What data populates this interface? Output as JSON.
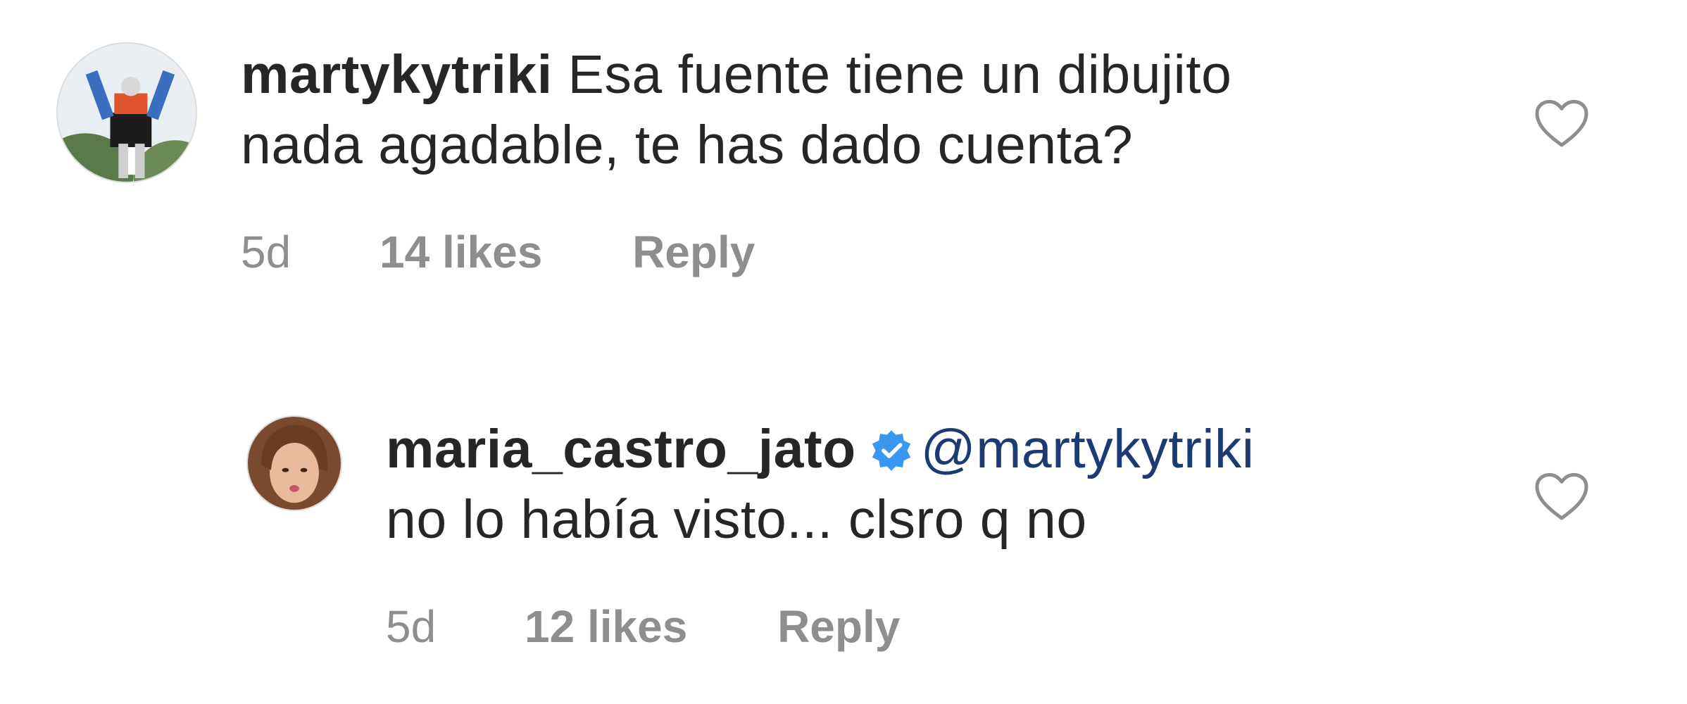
{
  "comments": [
    {
      "username": "martykytriki",
      "text_line1": "Esa fuente tiene un dibujito",
      "text_line2": "nada agadable, te has dado cuenta?",
      "time": "5d",
      "likes": "14 likes",
      "reply": "Reply",
      "verified": false,
      "avatar_icon": "robot-statue-avatar",
      "like_icon": "heart-outline-icon"
    },
    {
      "username": "maria_castro_jato",
      "mention": "@martykytriki",
      "text": "no lo había visto... clsro q no",
      "time": "5d",
      "likes": "12 likes",
      "reply": "Reply",
      "verified": true,
      "avatar_icon": "woman-portrait-avatar",
      "like_icon": "heart-outline-icon"
    }
  ],
  "colors": {
    "text": "#262626",
    "meta": "#8e8e8e",
    "mention": "#1c3a73",
    "verified_badge": "#3897f0"
  }
}
